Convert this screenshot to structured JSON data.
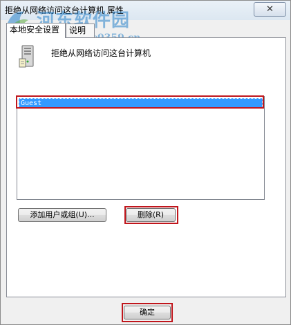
{
  "window": {
    "title": "拒绝从网络访问这台计算机 属性",
    "close_symbol": "✕"
  },
  "watermark": {
    "title": "河东软件园",
    "url": "www.pc0359.cn"
  },
  "tabs": [
    {
      "label": "本地安全设置",
      "active": true
    },
    {
      "label": "说明",
      "active": false
    }
  ],
  "policy": {
    "name": "拒绝从网络访问这台计算机",
    "icon": "server-computer-icon"
  },
  "users_list": {
    "items": [
      {
        "label": "Guest",
        "selected": true
      }
    ]
  },
  "buttons": {
    "add_label": "添加用户或组(U)...",
    "remove_label": "删除(R)",
    "ok_label": "确定"
  },
  "colors": {
    "selection": "#3399ff",
    "highlight_box": "#c0161c",
    "watermark": "#2882c8"
  }
}
